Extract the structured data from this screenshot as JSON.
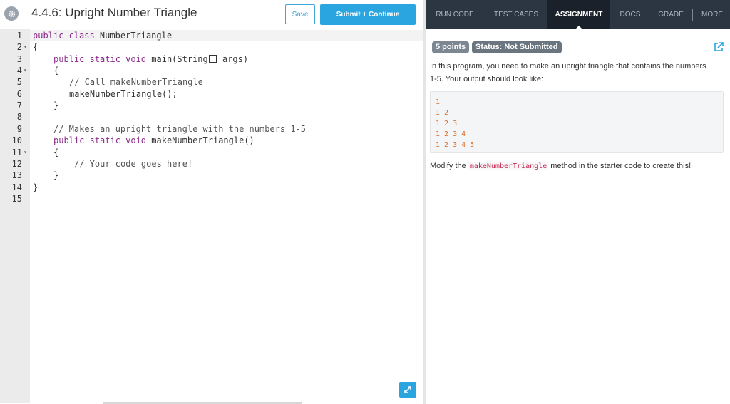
{
  "header": {
    "title": "4.4.6: Upright Number Triangle",
    "save_label": "Save",
    "submit_label": "Submit + Continue"
  },
  "editor": {
    "line_numbers": [
      "1",
      "2",
      "3",
      "4",
      "5",
      "6",
      "7",
      "8",
      "9",
      "10",
      "11",
      "12",
      "13",
      "14",
      "15"
    ],
    "lines": {
      "l1_kw": "public class",
      "l1_rest": " NumberTriangle",
      "l2": "{",
      "l3_kw": "public static void",
      "l3_a": " main(String",
      "l3_b": " args)",
      "l4": "{",
      "l5": "// Call makeNumberTriangle",
      "l6": "makeNumberTriangle();",
      "l7": "}",
      "l9": "// Makes an upright triangle with the numbers 1-5",
      "l10_kw": "public static void",
      "l10_rest": " makeNumberTriangle()",
      "l11": "{",
      "l12": "// Your code goes here!",
      "l13": "}",
      "l14": "}"
    }
  },
  "tabs": [
    {
      "label": "RUN CODE"
    },
    {
      "label": "TEST CASES"
    },
    {
      "label": "ASSIGNMENT"
    },
    {
      "label": "DOCS"
    },
    {
      "label": "GRADE"
    },
    {
      "label": "MORE"
    }
  ],
  "assignment": {
    "points": "5 points",
    "status": "Status: Not Submitted",
    "description": "In this program, you need to make an upright triangle that contains the numbers 1-5. Your output should look like:",
    "output_lines": [
      "1",
      "1 2",
      "1 2 3",
      "1 2 3 4",
      "1 2 3 4 5"
    ],
    "modify_prefix": "Modify the ",
    "modify_code": "makeNumberTriangle",
    "modify_suffix": " method in the starter code to create this!"
  },
  "colors": {
    "accent": "#2ba5e0",
    "tabbar": "#2c3642",
    "tab_active": "#1a212b",
    "keyword": "#8a2a8a",
    "output_text": "#d9702b"
  },
  "icons": {
    "settings": "gear-icon",
    "external_link": "external-link-icon",
    "expand": "expand-icon"
  }
}
